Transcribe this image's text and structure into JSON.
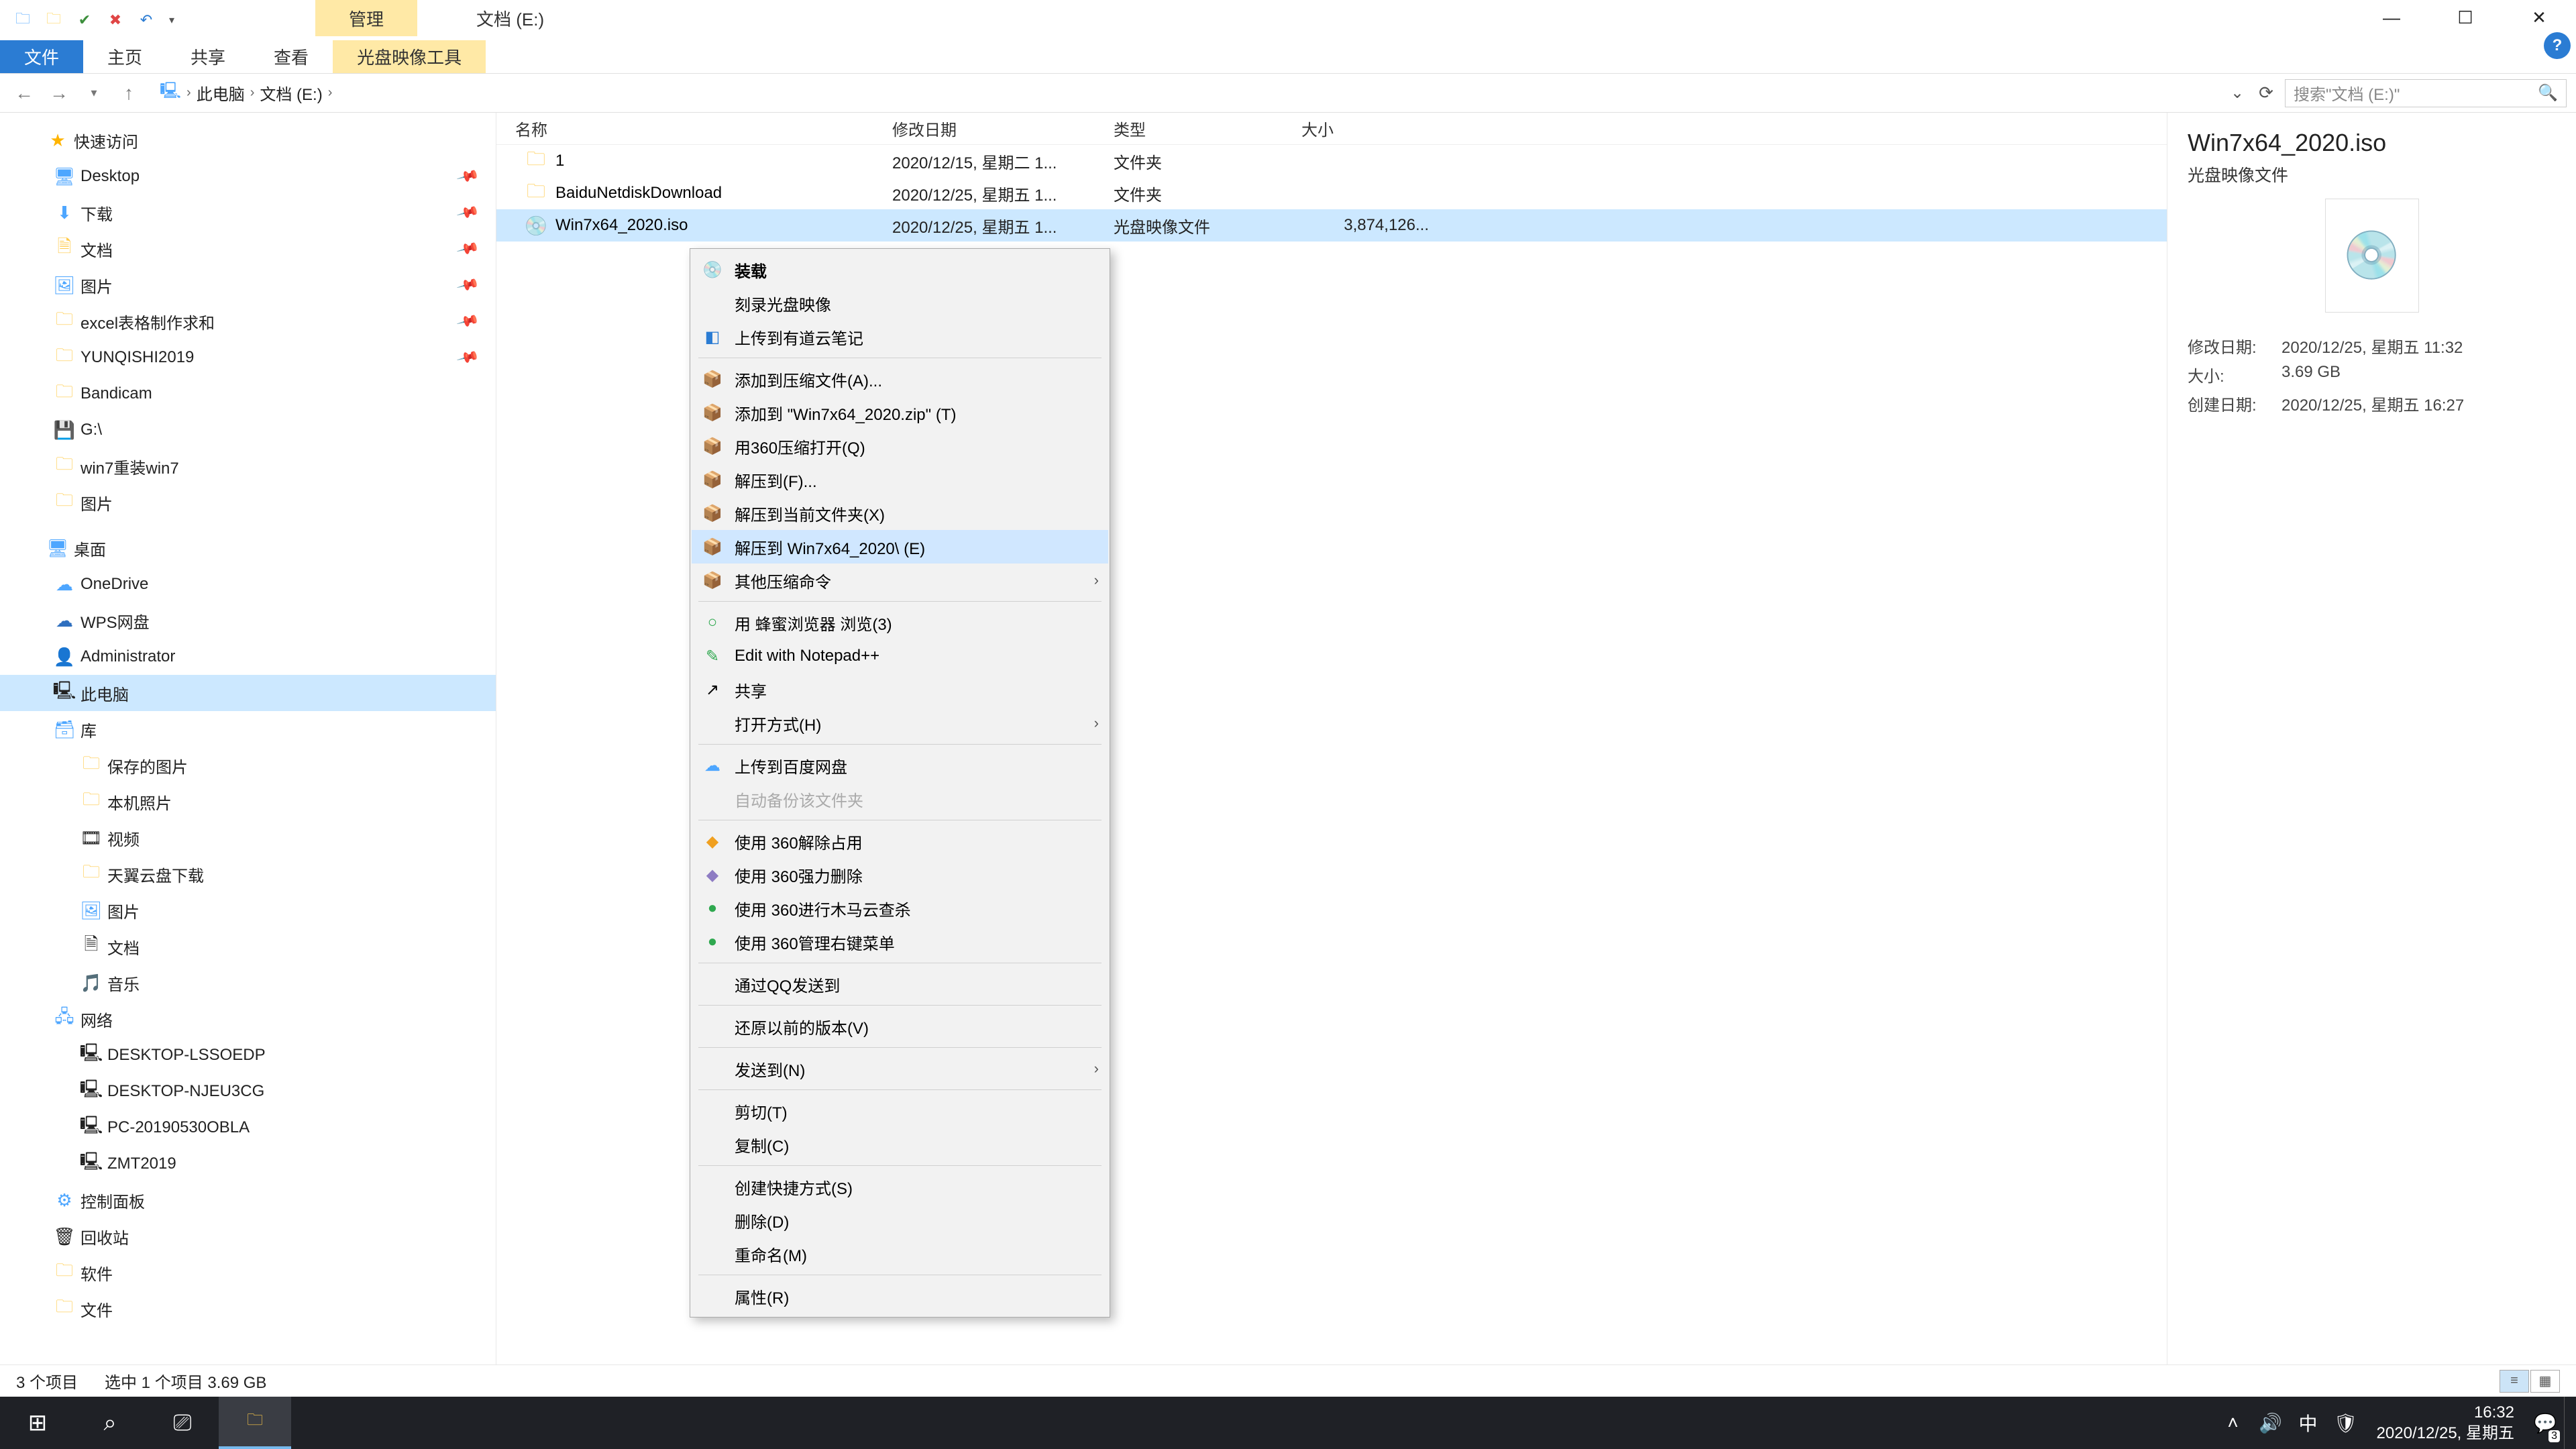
{
  "window_title": "文档 (E:)",
  "contextual_tab_title": "管理",
  "ribbon_tabs": {
    "file": "文件",
    "home": "主页",
    "share": "共享",
    "view": "查看",
    "disc_tools": "光盘映像工具"
  },
  "nav": {
    "this_pc": "此电脑",
    "drive": "文档 (E:)"
  },
  "search": {
    "placeholder": "搜索\"文档 (E:)\""
  },
  "columns": {
    "name": "名称",
    "date": "修改日期",
    "type": "类型",
    "size": "大小"
  },
  "rows": [
    {
      "icon": "folder",
      "name": "1",
      "date": "2020/12/15, 星期二 1...",
      "type": "文件夹",
      "size": ""
    },
    {
      "icon": "folder",
      "name": "BaiduNetdiskDownload",
      "date": "2020/12/25, 星期五 1...",
      "type": "文件夹",
      "size": ""
    },
    {
      "icon": "disc",
      "name": "Win7x64_2020.iso",
      "date": "2020/12/25, 星期五 1...",
      "type": "光盘映像文件",
      "size": "3,874,126..."
    }
  ],
  "tree": {
    "quick": "快速访问",
    "items_quick": [
      "Desktop",
      "下载",
      "文档",
      "图片",
      "excel表格制作求和",
      "YUNQISHI2019",
      "Bandicam",
      "G:\\",
      "win7重装win7",
      "图片"
    ],
    "desktop": "桌面",
    "items_desktop": [
      "OneDrive",
      "WPS网盘",
      "Administrator",
      "此电脑",
      "库"
    ],
    "lib_items": [
      "保存的图片",
      "本机照片",
      "视频",
      "天翼云盘下载",
      "图片",
      "文档",
      "音乐"
    ],
    "network": "网络",
    "net_items": [
      "DESKTOP-LSSOEDP",
      "DESKTOP-NJEU3CG",
      "PC-20190530OBLA",
      "ZMT2019"
    ],
    "bottom": [
      "控制面板",
      "回收站",
      "软件",
      "文件"
    ]
  },
  "pane": {
    "title": "Win7x64_2020.iso",
    "subtitle": "光盘映像文件",
    "modify_label": "修改日期:",
    "modify_val": "2020/12/25, 星期五 11:32",
    "size_label": "大小:",
    "size_val": "3.69 GB",
    "create_label": "创建日期:",
    "create_val": "2020/12/25, 星期五 16:27"
  },
  "ctx": {
    "mount": "装载",
    "burn": "刻录光盘映像",
    "youdao": "上传到有道云笔记",
    "add_archive": "添加到压缩文件(A)...",
    "add_zip": "添加到 \"Win7x64_2020.zip\" (T)",
    "open_360": "用360压缩打开(Q)",
    "extract_to": "解压到(F)...",
    "extract_here": "解压到当前文件夹(X)",
    "extract_named": "解压到 Win7x64_2020\\ (E)",
    "other_zip": "其他压缩命令",
    "fengmi": "用 蜂蜜浏览器 浏览(3)",
    "npp": "Edit with Notepad++",
    "share": "共享",
    "open_with": "打开方式(H)",
    "baidu": "上传到百度网盘",
    "auto_backup": "自动备份该文件夹",
    "unlock360": "使用 360解除占用",
    "del360": "使用 360强力删除",
    "trojan360": "使用 360进行木马云查杀",
    "mgr360": "使用 360管理右键菜单",
    "qq": "通过QQ发送到",
    "restore": "还原以前的版本(V)",
    "send_to": "发送到(N)",
    "cut": "剪切(T)",
    "copy": "复制(C)",
    "shortcut": "创建快捷方式(S)",
    "delete": "删除(D)",
    "rename": "重命名(M)",
    "properties": "属性(R)"
  },
  "status": {
    "count": "3 个项目",
    "sel": "选中 1 个项目  3.69 GB"
  },
  "taskbar": {
    "time": "16:32",
    "date": "2020/12/25, 星期五",
    "ime": "中",
    "badge": "3"
  }
}
